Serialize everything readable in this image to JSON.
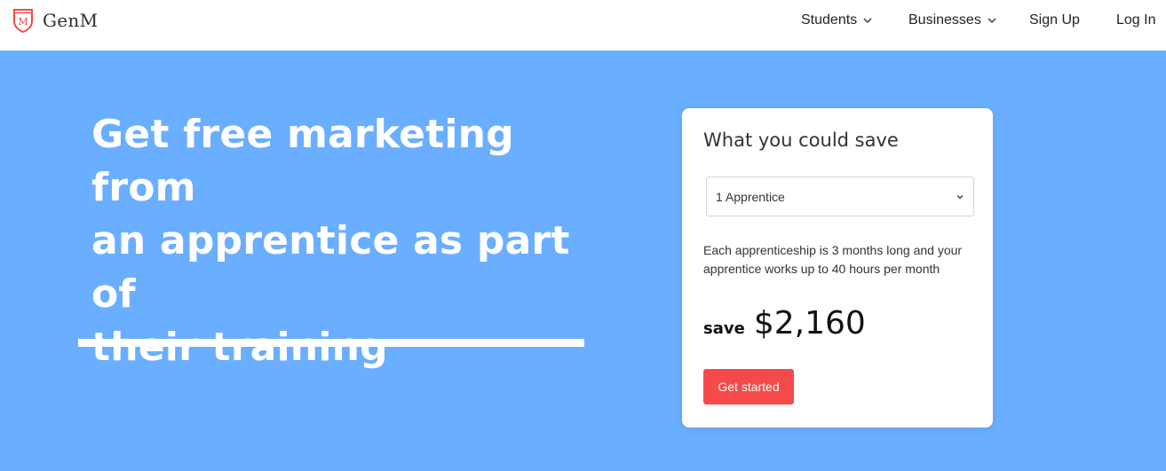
{
  "brand": {
    "name": "GenM",
    "logo_letter": "M",
    "accent": "#e84c4c"
  },
  "nav": {
    "students": "Students",
    "businesses": "Businesses",
    "sign_up": "Sign Up",
    "log_in": "Log In"
  },
  "hero": {
    "headline_line1": "Get free marketing from",
    "headline_line2": "an apprentice as part of",
    "headline_line3": "their training",
    "background": "#6aaeff"
  },
  "card": {
    "title": "What you could save",
    "select_value": "1 Apprentice",
    "description": "Each apprenticeship is 3 months long and your apprentice works up to 40 hours per month",
    "save_label": "save",
    "save_amount": "$2,160",
    "cta_label": "Get started",
    "cta_color": "#f64a4a"
  }
}
